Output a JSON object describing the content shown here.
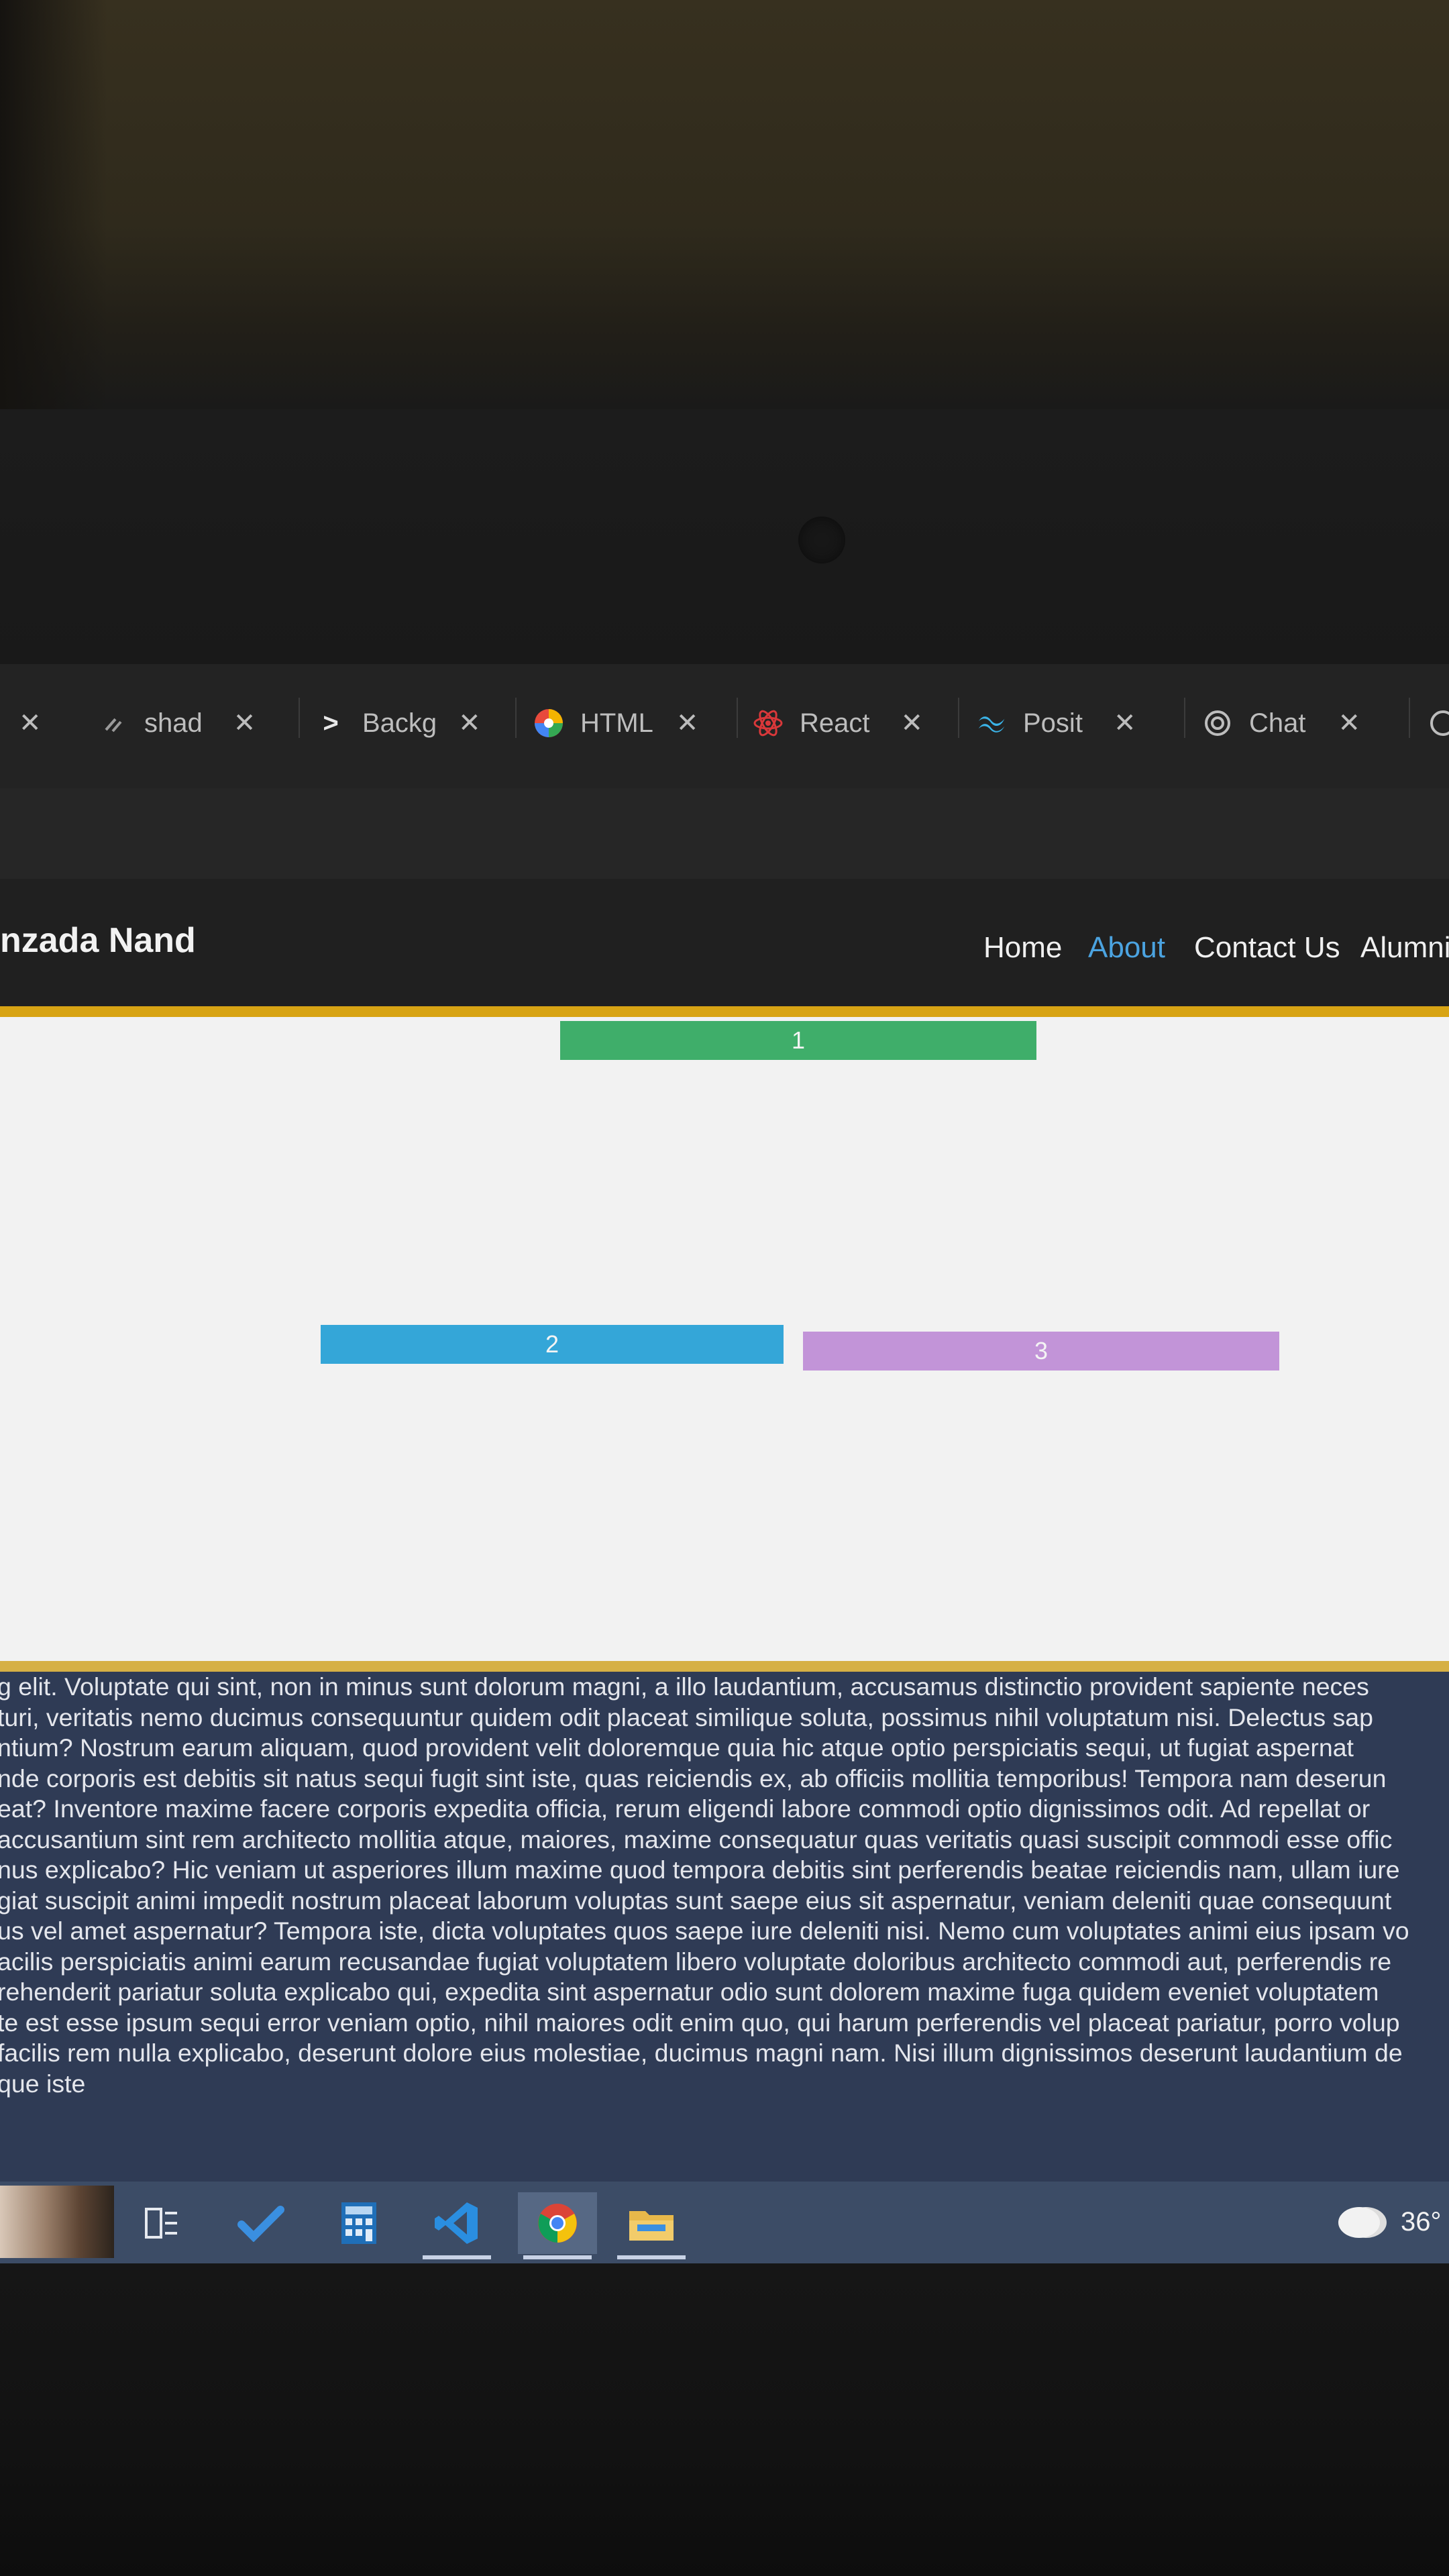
{
  "browser": {
    "tabs": [
      {
        "title": "",
        "icon": "blank-tab-icon"
      },
      {
        "title": "shad",
        "icon": "shadcn-icon"
      },
      {
        "title": "Backg",
        "icon": "terminal-prompt-icon"
      },
      {
        "title": "HTML",
        "icon": "color-wheel-icon"
      },
      {
        "title": "React",
        "icon": "react-atom-icon"
      },
      {
        "title": "Posit",
        "icon": "tailwind-icon"
      },
      {
        "title": "Chat",
        "icon": "chatgpt-icon"
      }
    ]
  },
  "site": {
    "brand": "nzada Nand",
    "nav": [
      "Home",
      "About",
      "Contact Us",
      "Alumni"
    ],
    "active_nav": "About",
    "boxes": [
      "1",
      "2",
      "3"
    ],
    "colors": {
      "border": "#d8a414",
      "box1": "#3fae6a",
      "box2": "#34a6d8",
      "box3": "#c294d8",
      "nav_active": "#4ba3e0"
    },
    "lorem_lines": [
      "g elit. Voluptate qui sint, non in minus sunt dolorum magni, a illo laudantium, accusamus distinctio provident sapiente neces",
      "turi, veritatis nemo ducimus consequuntur quidem odit placeat similique soluta, possimus nihil voluptatum nisi. Delectus sap",
      "ntium? Nostrum earum aliquam, quod provident velit doloremque quia hic atque optio perspiciatis sequi, ut fugiat aspernat",
      "nde corporis est debitis sit natus sequi fugit sint iste, quas reiciendis ex, ab officiis mollitia temporibus! Tempora nam deserun",
      "eat? Inventore maxime facere corporis expedita officia, rerum eligendi labore commodi optio dignissimos odit. Ad repellat or",
      "accusantium sint rem architecto mollitia atque, maiores, maxime consequatur quas veritatis quasi suscipit commodi esse offic",
      "nus explicabo? Hic veniam ut asperiores illum maxime quod tempora debitis sint perferendis beatae reiciendis nam, ullam iure",
      "giat suscipit animi impedit nostrum placeat laborum voluptas sunt saepe eius sit aspernatur, veniam deleniti quae consequunt",
      "us vel amet aspernatur? Tempora iste, dicta voluptates quos saepe iure deleniti nisi. Nemo cum voluptates animi eius ipsam vo",
      "acilis perspiciatis animi earum recusandae fugiat voluptatem libero voluptate doloribus architecto commodi aut, perferendis re",
      "rehenderit pariatur soluta explicabo qui, expedita sint aspernatur odio sunt dolorem maxime fuga quidem eveniet voluptatem",
      "te est esse ipsum sequi error veniam optio, nihil maiores odit enim quo, qui harum perferendis vel placeat pariatur, porro volup",
      "facilis rem nulla explicabo, deserunt dolore eius molestiae, ducimus magni nam. Nisi illum dignissimos deserunt laudantium de",
      "que iste"
    ]
  },
  "taskbar": {
    "apps": [
      "task-view-icon",
      "todo-check-icon",
      "calculator-icon",
      "vscode-icon",
      "chrome-icon",
      "file-explorer-icon"
    ],
    "temperature": "36°"
  }
}
